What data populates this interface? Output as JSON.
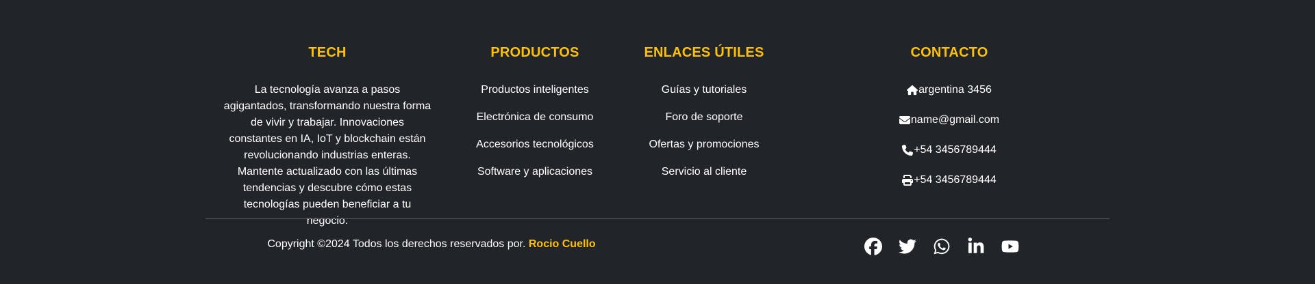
{
  "colors": {
    "background": "#212529",
    "accent": "#ffc107",
    "text": "#ffffff",
    "divider": "#5c6166"
  },
  "tech": {
    "title": "TECH",
    "description": "La tecnología avanza a pasos agigantados, transformando nuestra forma de vivir y trabajar. Innovaciones constantes en IA, IoT y blockchain están revolucionando industrias enteras. Mantente actualizado con las últimas tendencias y descubre cómo estas tecnologías pueden beneficiar a tu negocio."
  },
  "productos": {
    "title": "PRODUCTOS",
    "items": [
      "Productos inteligentes",
      "Electrónica de consumo",
      "Accesorios tecnológicos",
      "Software y aplicaciones"
    ]
  },
  "enlaces": {
    "title": "ENLACES ÚTILES",
    "items": [
      "Guías y tutoriales",
      "Foro de soporte",
      "Ofertas y promociones",
      "Servicio al cliente"
    ]
  },
  "contacto": {
    "title": "CONTACTO",
    "items": [
      {
        "icon": "home-icon",
        "text": "argentina 3456"
      },
      {
        "icon": "envelope-icon",
        "text": "name@gmail.com"
      },
      {
        "icon": "phone-icon",
        "text": "+54 3456789444"
      },
      {
        "icon": "print-icon",
        "text": "+54 3456789444"
      }
    ]
  },
  "footer": {
    "copyright": "Copyright ©2024 Todos los derechos reservados por.",
    "author": "Rocio Cuello",
    "social": [
      "facebook-icon",
      "twitter-icon",
      "whatsapp-icon",
      "linkedin-icon",
      "youtube-icon"
    ]
  }
}
